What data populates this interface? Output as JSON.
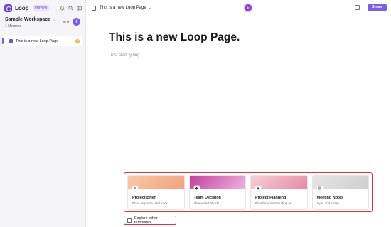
{
  "app": {
    "name": "Loop",
    "badge": "Preview"
  },
  "top_icons": [
    "bell-icon",
    "search-icon",
    "panel-icon"
  ],
  "workspace": {
    "name": "Sample Workspace",
    "members": "1 Member",
    "chevron": "◇",
    "menu": "≡∨",
    "add": "+"
  },
  "sidebar": {
    "pages": [
      {
        "label": "This is a new Loop Page",
        "avatar": "E"
      }
    ]
  },
  "header": {
    "doc_title": "This is a new Loop Page",
    "chevron": "⌄",
    "avatar": "E",
    "share_label": "Share"
  },
  "page": {
    "heading": "This is a new Loop Page.",
    "placeholder": "Just start typing..."
  },
  "templates": [
    {
      "title": "Project Brief",
      "desc": "Plan, organize, and track",
      "icon": "✎",
      "thumb_colors": [
        "#f9c9a6",
        "#f3a27a"
      ]
    },
    {
      "title": "Team Decision",
      "desc": "Ideate and decide",
      "icon": "◆",
      "thumb_colors": [
        "#c23f9b",
        "#f2b3e2"
      ]
    },
    {
      "title": "Project Planning",
      "desc": "Plan for understanding an...",
      "icon": "◈",
      "thumb_colors": [
        "#f6cfd8",
        "#e98aa6"
      ]
    },
    {
      "title": "Meeting Notes",
      "desc": "Sync and share",
      "icon": "▤",
      "thumb_colors": [
        "#e5e5e5",
        "#cfcfcf"
      ]
    }
  ],
  "explore": {
    "label": "Explore other templates"
  },
  "colors": {
    "accent": "#7a5cf0",
    "highlight_border": "#e0313c"
  }
}
